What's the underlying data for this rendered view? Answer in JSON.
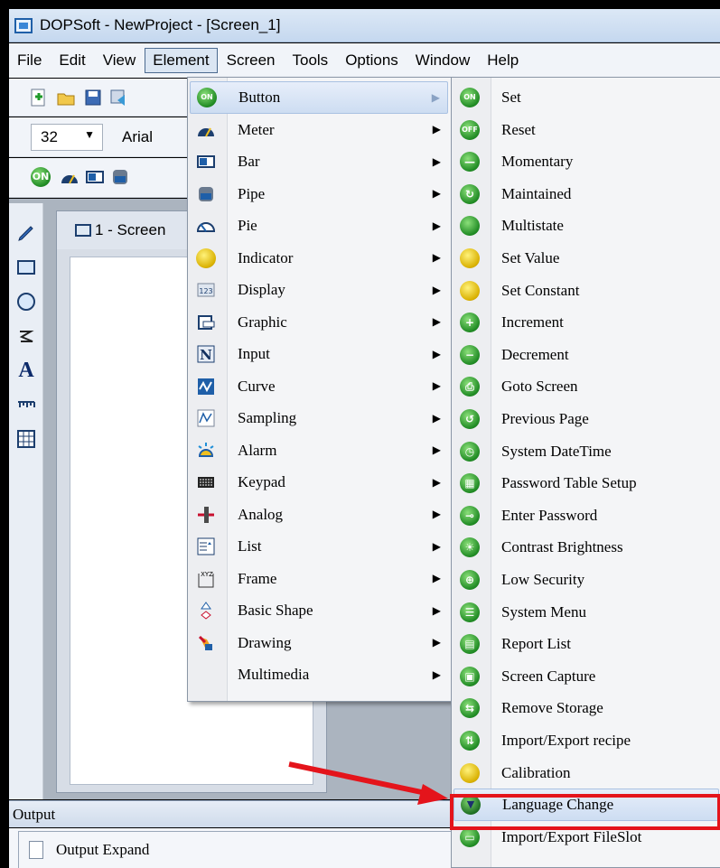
{
  "window": {
    "title": "DOPSoft - NewProject - [Screen_1]"
  },
  "menubar": [
    "File",
    "Edit",
    "View",
    "Element",
    "Screen",
    "Tools",
    "Options",
    "Window",
    "Help"
  ],
  "toolbar": {
    "font_size": "32",
    "font_name": "Arial"
  },
  "screen_tab": {
    "label": "1 - Screen"
  },
  "element_menu": [
    {
      "label": "Button",
      "icon": "on-button-icon"
    },
    {
      "label": "Meter",
      "icon": "meter-icon"
    },
    {
      "label": "Bar",
      "icon": "bar-icon"
    },
    {
      "label": "Pipe",
      "icon": "pipe-icon"
    },
    {
      "label": "Pie",
      "icon": "pie-icon"
    },
    {
      "label": "Indicator",
      "icon": "indicator-icon"
    },
    {
      "label": "Display",
      "icon": "display-icon"
    },
    {
      "label": "Graphic",
      "icon": "graphic-icon"
    },
    {
      "label": "Input",
      "icon": "input-icon"
    },
    {
      "label": "Curve",
      "icon": "curve-icon"
    },
    {
      "label": "Sampling",
      "icon": "sampling-icon"
    },
    {
      "label": "Alarm",
      "icon": "alarm-icon"
    },
    {
      "label": "Keypad",
      "icon": "keypad-icon"
    },
    {
      "label": "Analog",
      "icon": "analog-icon"
    },
    {
      "label": "List",
      "icon": "list-icon"
    },
    {
      "label": "Frame",
      "icon": "frame-icon"
    },
    {
      "label": "Basic Shape",
      "icon": "basic-shape-icon"
    },
    {
      "label": "Drawing",
      "icon": "drawing-icon"
    },
    {
      "label": "Multimedia",
      "icon": ""
    }
  ],
  "button_submenu": [
    {
      "label": "Set",
      "icon": "set-icon"
    },
    {
      "label": "Reset",
      "icon": "reset-icon"
    },
    {
      "label": "Momentary",
      "icon": "momentary-icon"
    },
    {
      "label": "Maintained",
      "icon": "maintained-icon"
    },
    {
      "label": "Multistate",
      "icon": "multistate-icon"
    },
    {
      "label": "Set Value",
      "icon": "set-value-icon"
    },
    {
      "label": "Set Constant",
      "icon": "set-constant-icon"
    },
    {
      "label": "Increment",
      "icon": "increment-icon"
    },
    {
      "label": "Decrement",
      "icon": "decrement-icon"
    },
    {
      "label": "Goto Screen",
      "icon": "goto-screen-icon"
    },
    {
      "label": "Previous Page",
      "icon": "previous-page-icon"
    },
    {
      "label": "System DateTime",
      "icon": "system-datetime-icon"
    },
    {
      "label": "Password Table Setup",
      "icon": "password-table-icon"
    },
    {
      "label": "Enter Password",
      "icon": "enter-password-icon"
    },
    {
      "label": "Contrast Brightness",
      "icon": "contrast-brightness-icon"
    },
    {
      "label": "Low Security",
      "icon": "low-security-icon"
    },
    {
      "label": "System Menu",
      "icon": "system-menu-icon"
    },
    {
      "label": "Report List",
      "icon": "report-list-icon"
    },
    {
      "label": "Screen Capture",
      "icon": "screen-capture-icon"
    },
    {
      "label": "Remove Storage",
      "icon": "remove-storage-icon"
    },
    {
      "label": "Import/Export recipe",
      "icon": "import-export-recipe-icon"
    },
    {
      "label": "Calibration",
      "icon": "calibration-icon"
    },
    {
      "label": "Language Change",
      "icon": "language-change-icon"
    },
    {
      "label": "Import/Export FileSlot",
      "icon": "import-export-fileslot-icon"
    }
  ],
  "output": {
    "title": "Output",
    "expand_label": "Output Expand"
  },
  "colors": {
    "annotation": "#e4141b",
    "menu_highlight": "#cdddf2",
    "icon_green": "#1f8a23",
    "icon_yellow": "#d9b000"
  }
}
